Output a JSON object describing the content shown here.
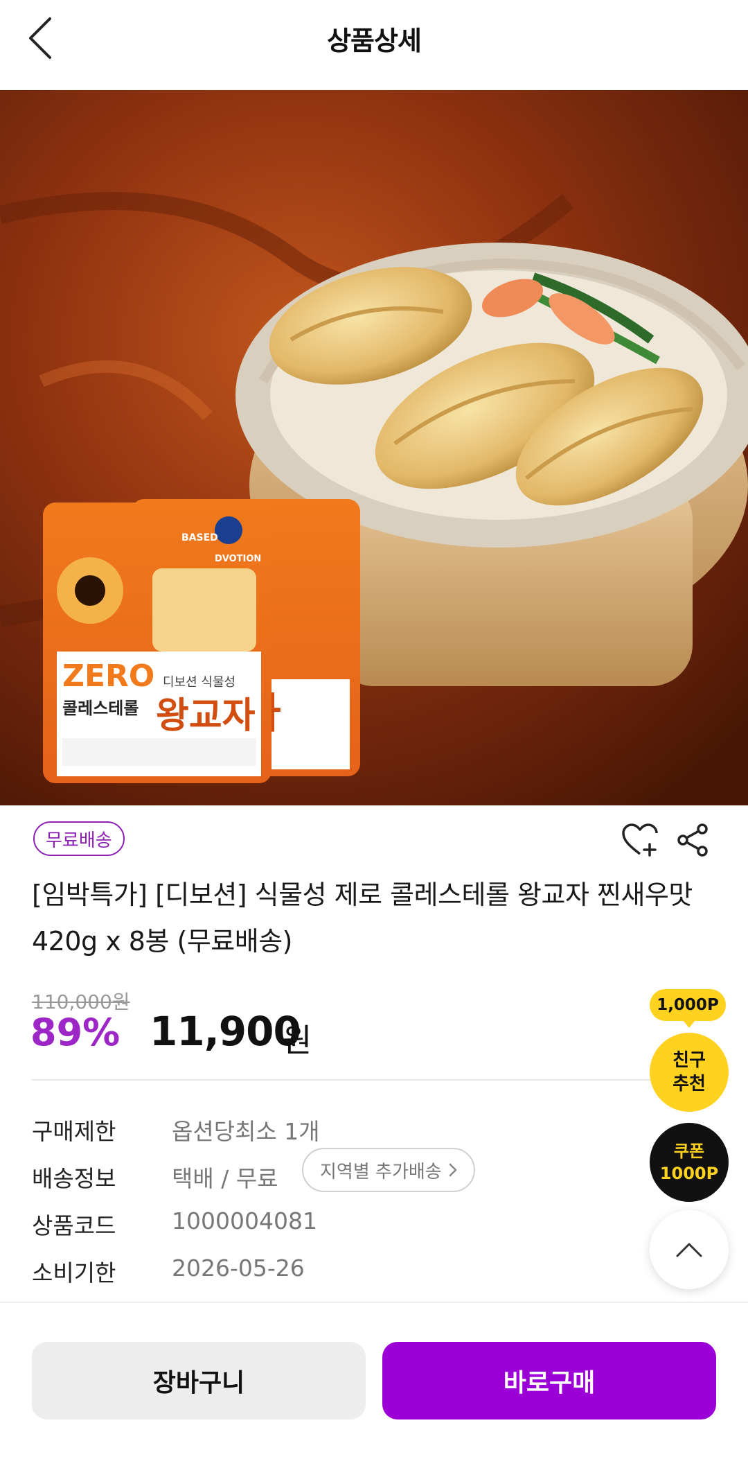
{
  "header": {
    "title": "상품상세"
  },
  "hero": {
    "package_brand": "DVOTION",
    "package_zero": "ZERO",
    "package_cholesterol": "콜레스테롤",
    "package_subtitle": "디보션 식물성",
    "package_name": "왕교자",
    "package_based": "BASED"
  },
  "product": {
    "badge": "무료배송",
    "title": "[임박특가] [디보션] 식물성 제로 콜레스테롤 왕교자 찐새우맛 420g x 8봉 (무료배송)",
    "original_price": "110,000원",
    "discount_rate": "89%",
    "price": "11,900",
    "price_unit": "원"
  },
  "info": {
    "rows": [
      {
        "label": "구매제한",
        "value": "옵션당최소 1개"
      },
      {
        "label": "배송정보",
        "value": "택배 / 무료"
      },
      {
        "label": "상품코드",
        "value": "1000004081"
      },
      {
        "label": "소비기한",
        "value": "2026-05-26"
      }
    ],
    "region_button": "지역별 추가배송"
  },
  "floating": {
    "points_badge": "1,000P",
    "friend_line1": "친구",
    "friend_line2": "추천",
    "coupon_line1": "쿠폰",
    "coupon_line2": "1000P"
  },
  "bottom": {
    "cart_label": "장바구니",
    "buy_label": "바로구매"
  },
  "colors": {
    "accent_purple": "#9b00d6",
    "discount_purple": "#9c27c6",
    "yellow": "#ffd21f"
  }
}
